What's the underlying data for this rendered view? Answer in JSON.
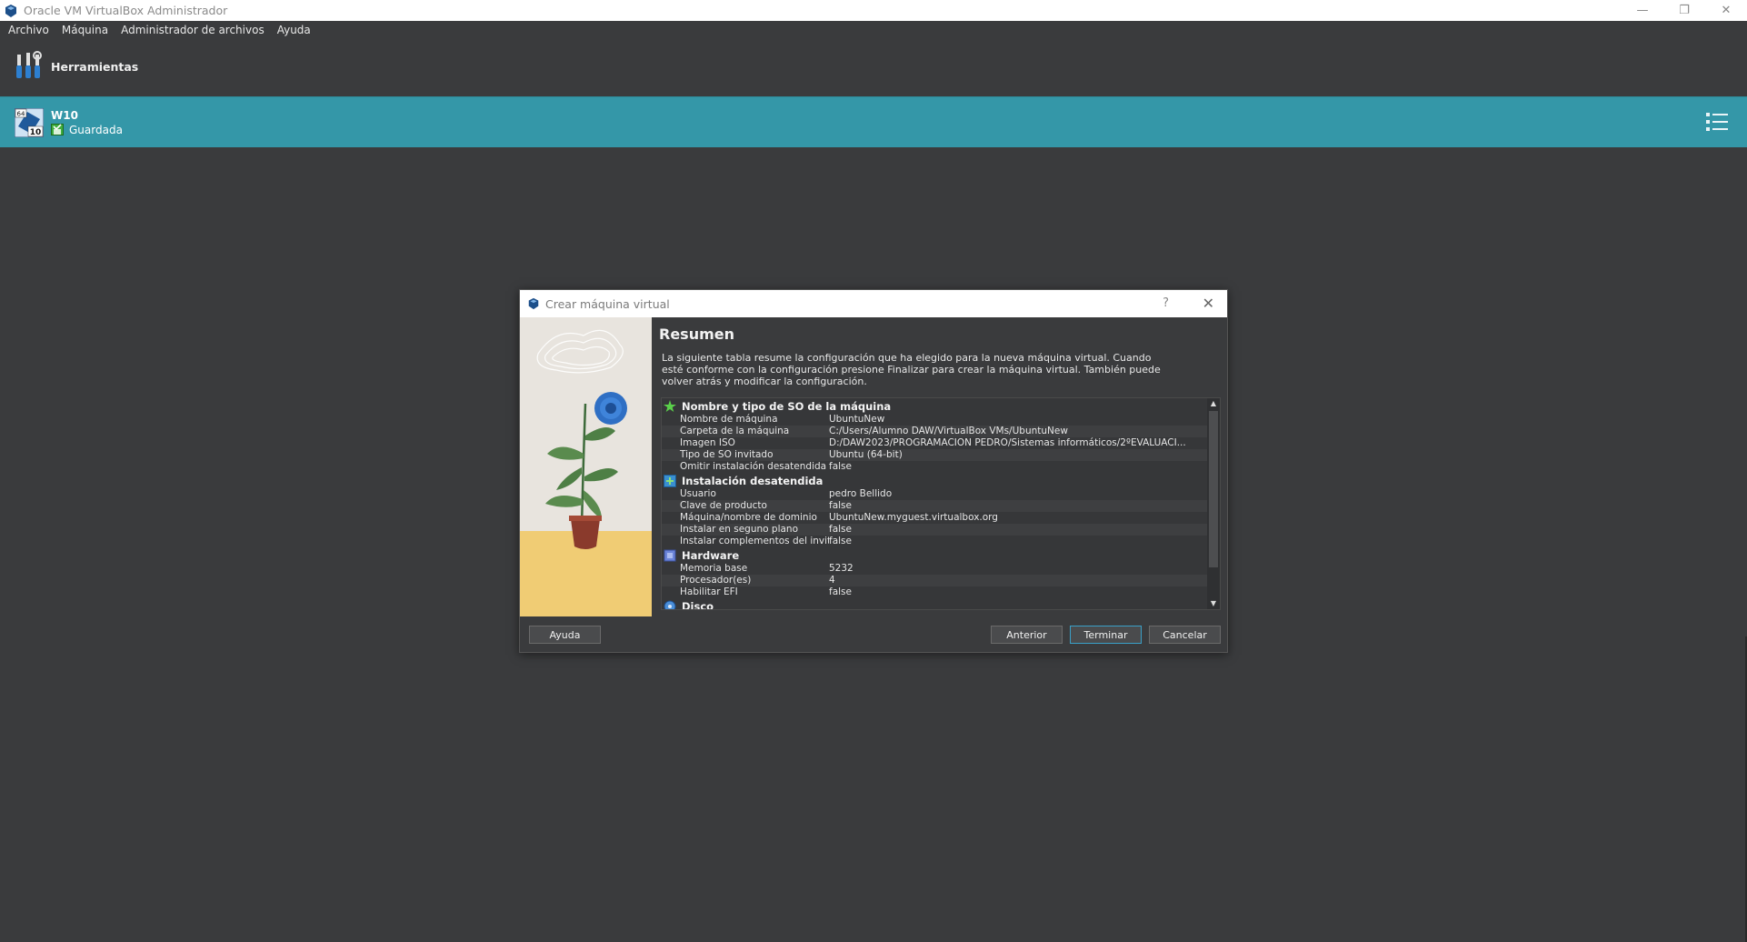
{
  "window": {
    "title": "Oracle VM VirtualBox Administrador",
    "controls": {
      "minimize": "—",
      "restore": "❐",
      "close": "✕"
    }
  },
  "menubar": {
    "items": [
      "Archivo",
      "Máquina",
      "Administrador de archivos",
      "Ayuda"
    ]
  },
  "tools": {
    "label": "Herramientas"
  },
  "vm": {
    "name": "W10",
    "state": "Guardada",
    "os_badge_top": "64",
    "os_badge_bottom": "10"
  },
  "dialog": {
    "title": "Crear máquina virtual",
    "help_glyph": "?",
    "close_glyph": "✕",
    "heading": "Resumen",
    "description": "La siguiente tabla resume la configuración que ha elegido para la nueva máquina virtual. Cuando esté conforme con la configuración presione Finalizar para crear la máquina virtual. También puede volver atrás y modificar la configuración.",
    "sections": [
      {
        "title": "Nombre y tipo de SO de la máquina",
        "icon": "star-icon",
        "rows": [
          {
            "key": "Nombre de máquina",
            "value": "UbuntuNew"
          },
          {
            "key": "Carpeta de la máquina",
            "value": "C:/Users/Alumno DAW/VirtualBox VMs/UbuntuNew"
          },
          {
            "key": "Imagen ISO",
            "value": "D:/DAW2023/PROGRAMACION PEDRO/Sistemas informáticos/2ºEVALUACI..."
          },
          {
            "key": "Tipo de SO invitado",
            "value": "Ubuntu (64-bit)"
          },
          {
            "key": "Omitir instalación desatendida",
            "value": "false"
          }
        ]
      },
      {
        "title": "Instalación desatendida",
        "icon": "unattended-install-icon",
        "rows": [
          {
            "key": "Usuario",
            "value": "pedro Bellido"
          },
          {
            "key": "Clave de producto",
            "value": "false"
          },
          {
            "key": "Máquina/nombre de dominio",
            "value": "UbuntuNew.myguest.virtualbox.org"
          },
          {
            "key": "Instalar en seguno plano",
            "value": "false"
          },
          {
            "key": "Instalar complementos del invitado",
            "value": "false"
          }
        ]
      },
      {
        "title": "Hardware",
        "icon": "hardware-icon",
        "rows": [
          {
            "key": "Memoria base",
            "value": "5232"
          },
          {
            "key": "Procesador(es)",
            "value": "4"
          },
          {
            "key": "Habilitar EFI",
            "value": "false"
          }
        ]
      },
      {
        "title": "Disco",
        "icon": "disk-icon",
        "rows": []
      }
    ],
    "buttons": {
      "help": "Ayuda",
      "previous": "Anterior",
      "finish": "Terminar",
      "cancel": "Cancelar"
    }
  },
  "colors": {
    "background": "#3a3b3d",
    "vm_selected": "#3497a8",
    "accent_focus": "#3aa0c8"
  }
}
